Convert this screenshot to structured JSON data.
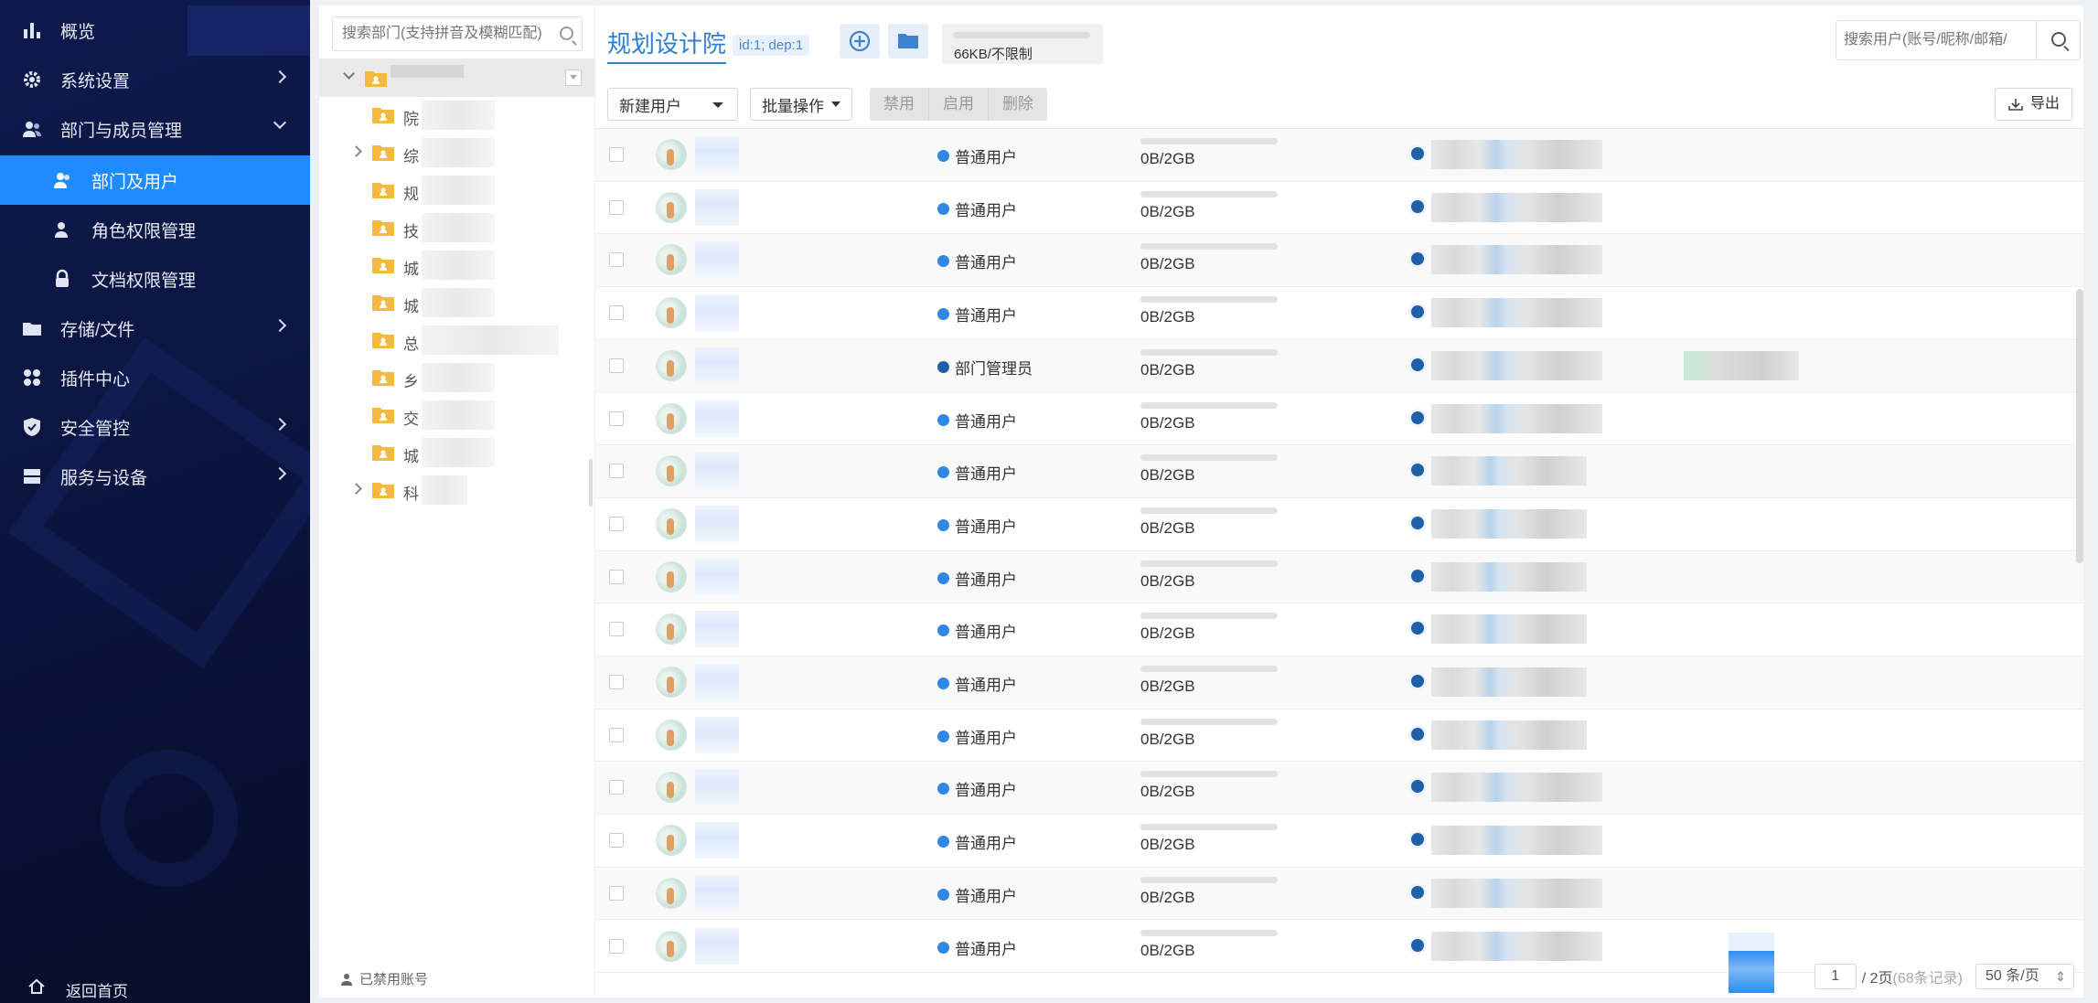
{
  "sidebar": {
    "items": [
      {
        "label": "概览",
        "icon": "bar-chart-icon"
      },
      {
        "label": "系统设置",
        "icon": "gear-icon"
      },
      {
        "label": "部门与成员管理",
        "icon": "users-icon"
      },
      {
        "label": "部门及用户",
        "icon": "user-icon"
      },
      {
        "label": "角色权限管理",
        "icon": "user-role-icon"
      },
      {
        "label": "文档权限管理",
        "icon": "lock-icon"
      },
      {
        "label": "存储/文件",
        "icon": "folder-icon"
      },
      {
        "label": "插件中心",
        "icon": "grid-icon"
      },
      {
        "label": "安全管控",
        "icon": "shield-icon"
      },
      {
        "label": "服务与设备",
        "icon": "server-icon"
      }
    ],
    "home_label": "返回首页"
  },
  "tree": {
    "search_placeholder": "搜索部门(支持拼音及模糊匹配)",
    "nodes": [
      "院",
      "综",
      "规",
      "技",
      "城",
      "城",
      "总",
      "乡",
      "交",
      "城",
      "科"
    ],
    "disabled_label": "已禁用账号"
  },
  "header": {
    "dept_name": "规划设计院",
    "dept_id": "id:1; dep:1",
    "quota_text": "66KB/不限制",
    "user_search_placeholder": "搜索用户(账号/昵称/邮箱/"
  },
  "toolbar": {
    "new_user": "新建用户",
    "batch": "批量操作",
    "disable": "禁用",
    "enable": "启用",
    "delete": "删除",
    "export": "导出"
  },
  "rows": [
    {
      "role": "普通用户",
      "quota": "0B/2GB"
    },
    {
      "role": "普通用户",
      "quota": "0B/2GB"
    },
    {
      "role": "普通用户",
      "quota": "0B/2GB"
    },
    {
      "role": "普通用户",
      "quota": "0B/2GB"
    },
    {
      "role": "部门管理员",
      "quota": "0B/2GB"
    },
    {
      "role": "普通用户",
      "quota": "0B/2GB"
    },
    {
      "role": "普通用户",
      "quota": "0B/2GB"
    },
    {
      "role": "普通用户",
      "quota": "0B/2GB"
    },
    {
      "role": "普通用户",
      "quota": "0B/2GB"
    },
    {
      "role": "普通用户",
      "quota": "0B/2GB"
    },
    {
      "role": "普通用户",
      "quota": "0B/2GB"
    },
    {
      "role": "普通用户",
      "quota": "0B/2GB"
    },
    {
      "role": "普通用户",
      "quota": "0B/2GB"
    },
    {
      "role": "普通用户",
      "quota": "0B/2GB"
    },
    {
      "role": "普通用户",
      "quota": "0B/2GB"
    },
    {
      "role": "普通用户",
      "quota": "0B/2GB"
    }
  ],
  "pager": {
    "current": "1",
    "total": "/ 2页",
    "records": "(68条记录)",
    "page_size": "50 条/页"
  },
  "colors": {
    "sidebar_bg": "#0b1540",
    "accent": "#1e8cff",
    "title": "#2f7fd0"
  }
}
